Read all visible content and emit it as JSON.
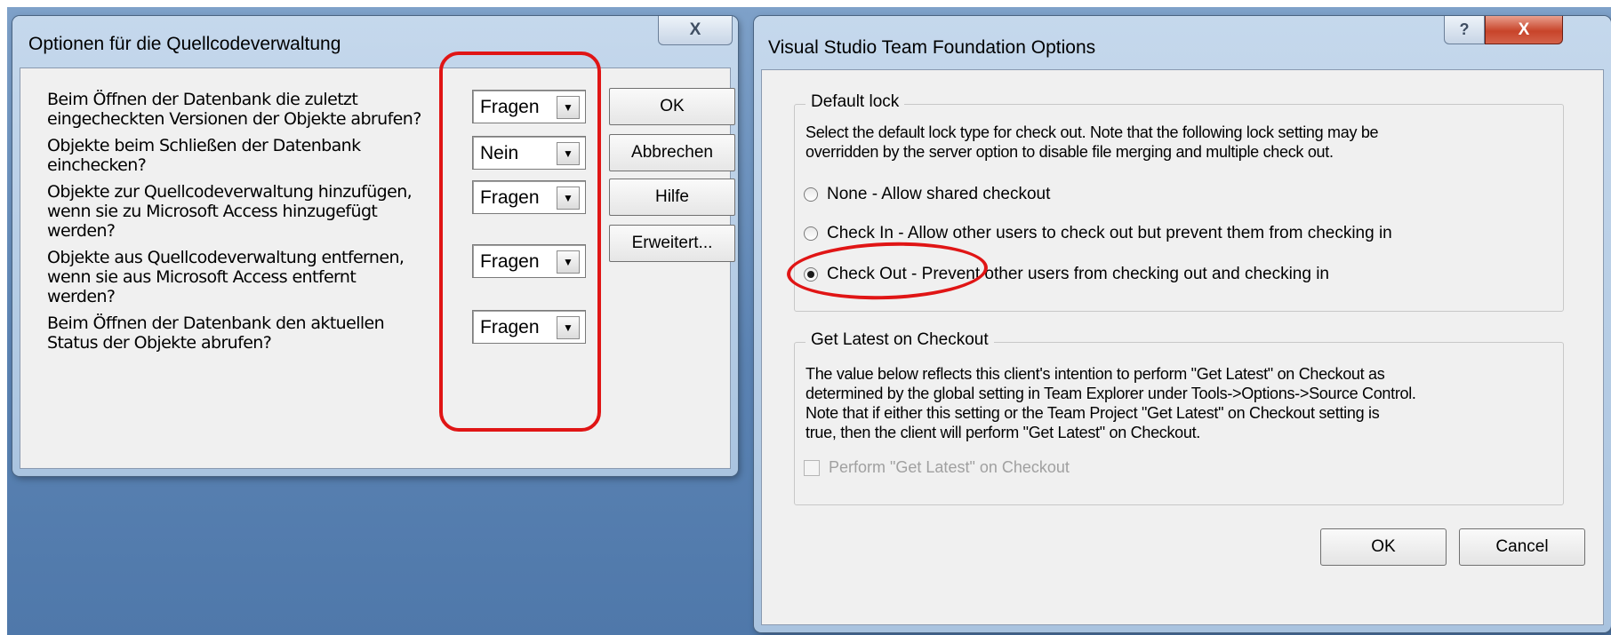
{
  "left_dialog": {
    "title": "Optionen für die Quellcodeverwaltung",
    "close_glyph": "X",
    "options": [
      {
        "label": "Beim Öffnen der Datenbank die zuletzt\neingecheckten Versionen der Objekte abrufen?",
        "value": "Fragen"
      },
      {
        "label": "Objekte beim Schließen der Datenbank\neinchecken?",
        "value": "Nein"
      },
      {
        "label": "Objekte zur Quellcodeverwaltung hinzufügen,\nwenn sie zu Microsoft Access hinzugefügt\nwerden?",
        "value": "Fragen"
      },
      {
        "label": "Objekte aus Quellcodeverwaltung entfernen,\nwenn sie aus Microsoft Access entfernt\nwerden?",
        "value": "Fragen"
      },
      {
        "label": "Beim Öffnen der Datenbank den aktuellen\nStatus der Objekte abrufen?",
        "value": "Fragen"
      }
    ],
    "buttons": {
      "ok": "OK",
      "cancel": "Abbrechen",
      "help": "Hilfe",
      "advanced": "Erweitert..."
    }
  },
  "right_dialog": {
    "title": "Visual Studio Team Foundation Options",
    "help_glyph": "?",
    "close_glyph": "X",
    "default_lock": {
      "legend": "Default lock",
      "description": "Select the default lock type for check out. Note that the following lock setting may be\noverridden by the server option to disable file merging and multiple check out.",
      "options": [
        {
          "label": "None - Allow shared checkout",
          "checked": false
        },
        {
          "label": "Check In - Allow other users to check out but prevent them from checking in",
          "checked": false
        },
        {
          "label": "Check Out - Prevent other users from checking out and checking in",
          "checked": true
        }
      ]
    },
    "get_latest": {
      "legend": "Get Latest on Checkout",
      "description": "The value below reflects this client's intention to perform \"Get Latest\" on Checkout as\ndetermined by the global setting in Team Explorer under Tools->Options->Source Control.\nNote that if either this setting or the Team Project \"Get Latest\" on Checkout setting is\ntrue, then the client will perform \"Get Latest\" on Checkout.",
      "checkbox_label": "Perform \"Get Latest\" on Checkout",
      "checkbox_checked": false,
      "checkbox_enabled": false
    },
    "buttons": {
      "ok": "OK",
      "cancel": "Cancel"
    }
  },
  "colors": {
    "highlight": "#e01515",
    "desktop": "#5c84b4",
    "dialog_face": "#f0f0f0",
    "close_button": "#c8442a"
  }
}
